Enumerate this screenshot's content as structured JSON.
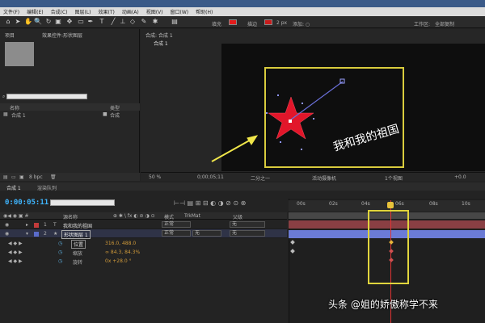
{
  "menu": {
    "items": [
      "文件(F)",
      "编辑(E)",
      "合成(C)",
      "图层(L)",
      "效果(T)",
      "动画(A)",
      "视图(V)",
      "窗口(W)",
      "帮助(H)"
    ]
  },
  "toolbar": {
    "fill_label": "填充",
    "stroke_label": "描边",
    "stroke_size": "2 px",
    "workspace_label": "工作区:",
    "workspace_value": "全部复制"
  },
  "project_panel": {
    "tab_project": "项目",
    "tab_effects": "效果控件:形状图层",
    "header_name": "名称",
    "header_type": "类型",
    "item_name": "合成 1",
    "item_type": "合成",
    "footer_bpc": "8 bpc"
  },
  "viewer": {
    "tab_label": "合成: 合成 1",
    "subtab_label": "合成 1",
    "canvas_text": "我和我的祖国",
    "zoom": "50 %",
    "timecode": "0;00;05;11",
    "resolution": "二分之一",
    "camera": "活动摄像机",
    "views": "1个视图",
    "exposure": "+0.0"
  },
  "timeline": {
    "tab_label": "合成 1",
    "tab_render": "渲染队列",
    "timecode": "0:00:05:11",
    "col_layer_name": "源名称",
    "col_mode": "模式",
    "col_trkmat": "TrkMat",
    "col_parent": "父级",
    "layers": [
      {
        "index": "1",
        "name": "我和我的祖国",
        "mode": "正常",
        "trkmat": "",
        "parent": "无",
        "color": "#c23b3b"
      },
      {
        "index": "2",
        "name": "形状图层 1",
        "mode": "正常",
        "trkmat": "无",
        "parent": "无",
        "color": "#5a6ccc"
      }
    ],
    "props": [
      {
        "name": "位置",
        "value": "316.0, 488.0"
      },
      {
        "name": "缩放",
        "value": "∞ 84.3, 84.3%"
      },
      {
        "name": "旋转",
        "value": "0x +28.0 °"
      }
    ],
    "ruler_labels": [
      "00s",
      "02s",
      "04s",
      "06s",
      "08s",
      "10s"
    ]
  },
  "watermark": "头条 @姐的娇傲称学不来",
  "colors": {
    "comp_frame": "#d9cc3d",
    "playhead": "#e03333",
    "layer1_bar": "#8a3f43",
    "layer2_bar": "#6b7bd6",
    "timecode": "#3fb6ff"
  }
}
